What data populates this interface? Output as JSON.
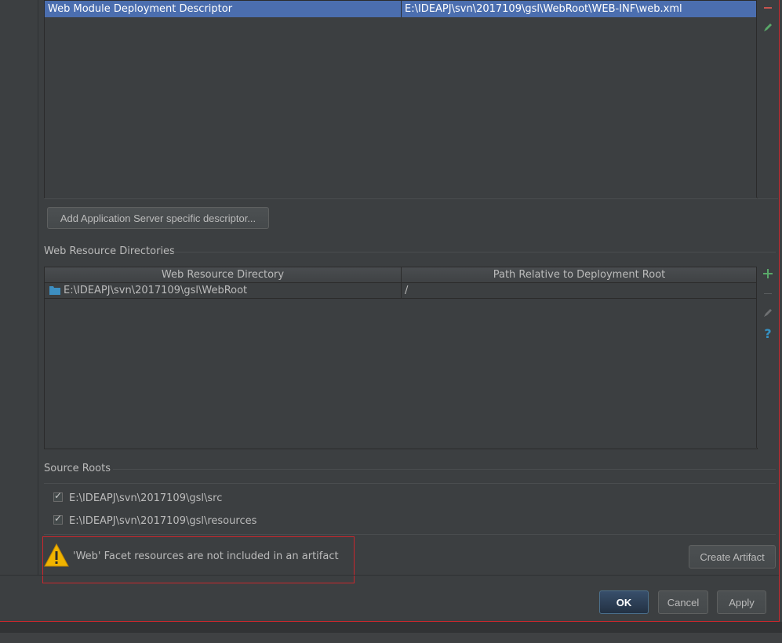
{
  "descriptors": {
    "rows": [
      {
        "type": "Web Module Deployment Descriptor",
        "path": "E:\\IDEAPJ\\svn\\2017109\\gsl\\WebRoot\\WEB-INF\\web.xml"
      }
    ],
    "add_server_descriptor_label": "Add Application Server specific descriptor..."
  },
  "web_resources": {
    "title": "Web Resource Directories",
    "headers": [
      "Web Resource Directory",
      "Path Relative to Deployment Root"
    ],
    "rows": [
      {
        "directory": "E:\\IDEAPJ\\svn\\2017109\\gsl\\WebRoot",
        "relative": "/"
      }
    ]
  },
  "source_roots": {
    "title": "Source Roots",
    "items": [
      {
        "path": "E:\\IDEAPJ\\svn\\2017109\\gsl\\src",
        "checked": true
      },
      {
        "path": "E:\\IDEAPJ\\svn\\2017109\\gsl\\resources",
        "checked": true
      }
    ]
  },
  "warning": {
    "text": "'Web' Facet resources are not included in an artifact",
    "create_artifact_label": "Create Artifact"
  },
  "footer": {
    "ok_label": "OK",
    "cancel_label": "Cancel",
    "apply_label": "Apply"
  },
  "colors": {
    "background": "#3c3f41",
    "selection": "#4b6eaf",
    "add_green": "#59a869",
    "remove_red": "#c75450",
    "help_blue": "#3592c4",
    "highlight_red": "#c9272d"
  },
  "icons": [
    "remove-icon",
    "edit-icon",
    "add-icon",
    "help-icon",
    "folder-icon",
    "warning-icon",
    "checkbox-icon"
  ]
}
